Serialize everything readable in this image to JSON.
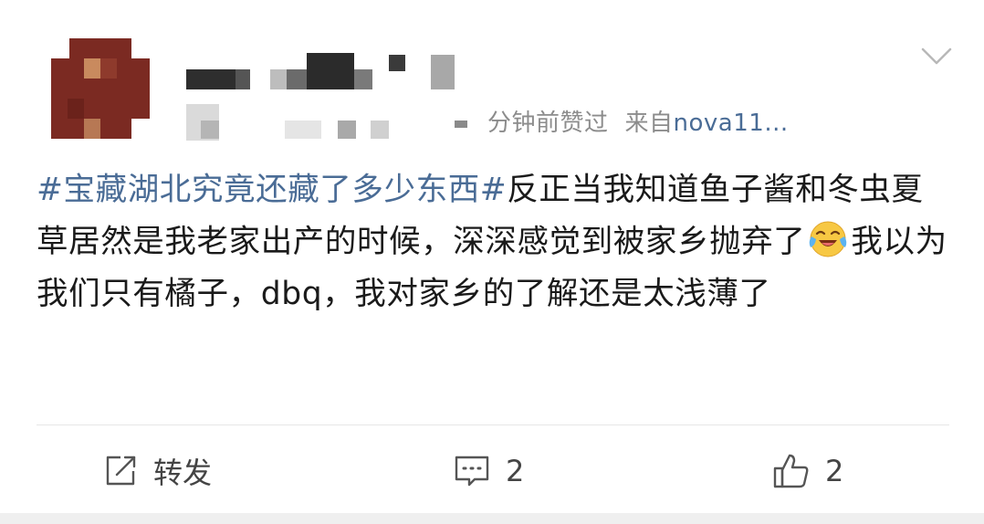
{
  "post": {
    "meta": {
      "time": "分钟前赞过",
      "source_prefix": "来自",
      "device": "nova11..."
    },
    "content": {
      "topic": "#宝藏湖北究竟还藏了多少东西#",
      "text_part1": "反正当我知道鱼子酱和冬虫夏草居然是我老家出产的时候，深深感觉到被家乡抛弃了",
      "emoji": "laughing-crying-emoji",
      "text_part2": "我以为我们只有橘子，dbq，我对家乡的了解还是太浅薄了"
    },
    "actions": {
      "repost_label": "转发",
      "comment_count": "2",
      "like_count": "2"
    }
  },
  "colors": {
    "topic_link": "#4a6c96",
    "meta_gray": "#8c8c8c",
    "avatar_red": "#7b2a22"
  }
}
